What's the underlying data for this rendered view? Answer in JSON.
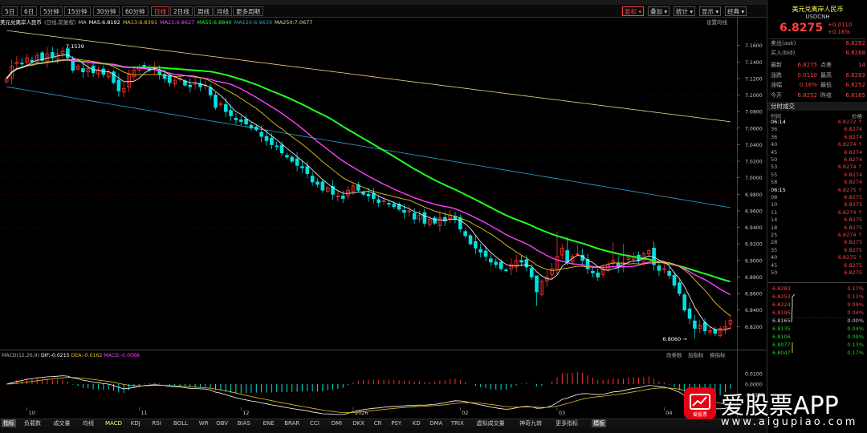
{
  "toolbar": {
    "periods": [
      "5日",
      "6日",
      "5分钟",
      "15分钟",
      "30分钟",
      "60分钟",
      "日线",
      "2日线",
      "周线",
      "月线",
      "更多周期"
    ],
    "active_index": 6,
    "right_buttons": [
      "复权",
      "叠加",
      "统计",
      "显示",
      "经典"
    ]
  },
  "info": {
    "symbol": "美元兑离岸人民币",
    "note": "(日线,前复权)",
    "ma_label": "MA",
    "ma5": "MA5:6.8192",
    "ma13": "MA13:6.8391",
    "ma21": "MA21:6.8627",
    "ma55": "MA55:6.8840",
    "ma120": "MA120:6.9639",
    "ma250": "MA250:7.0677",
    "settings": "设置均线"
  },
  "colors": {
    "up": "#ff3030",
    "down": "#00e0e0",
    "ma5": "#ffffff",
    "ma13": "#e8c020",
    "ma21": "#ff40ff",
    "ma55": "#20ff20",
    "ma120": "#30a0d0",
    "ma250": "#e8d890",
    "grid": "#6a0000",
    "axis_text": "#c8c8c8"
  },
  "chart_data": {
    "type": "candlestick",
    "ylim": [
      6.8,
      7.18
    ],
    "y_ticks": [
      7.16,
      7.14,
      7.12,
      7.1,
      7.08,
      7.06,
      7.04,
      7.02,
      7.0,
      6.98,
      6.96,
      6.94,
      6.92,
      6.9,
      6.88,
      6.86,
      6.84,
      6.82
    ],
    "y_tick_labels": [
      "7.1600",
      "7.1400",
      "7.1200",
      "7.1000",
      "7.0800",
      "7.0600",
      "7.0400",
      "7.0200",
      "7.0000",
      "6.9800",
      "6.9600",
      "6.9400",
      "6.9200",
      "6.9000",
      "6.8800",
      "6.8600",
      "6.8400",
      "6.8200"
    ],
    "x_labels": [
      {
        "label": "10",
        "index": 4
      },
      {
        "label": "11",
        "index": 26
      },
      {
        "label": "12",
        "index": 46
      },
      {
        "label": "2026",
        "index": 68
      },
      {
        "label": "02",
        "index": 89
      },
      {
        "label": "03",
        "index": 108
      },
      {
        "label": "04",
        "index": 129
      }
    ],
    "high_annotation": {
      "label": "7.1539",
      "index": 11,
      "value": 7.1539
    },
    "low_annotation": {
      "label": "6.8060",
      "index": 135,
      "value": 6.806
    },
    "closes": [
      7.12,
      7.135,
      7.14,
      7.138,
      7.145,
      7.14,
      7.148,
      7.142,
      7.15,
      7.146,
      7.15,
      7.153,
      7.145,
      7.13,
      7.135,
      7.128,
      7.132,
      7.127,
      7.13,
      7.125,
      7.128,
      7.115,
      7.105,
      7.108,
      7.125,
      7.13,
      7.133,
      7.135,
      7.13,
      7.132,
      7.125,
      7.12,
      7.115,
      7.118,
      7.12,
      7.112,
      7.11,
      7.115,
      7.11,
      7.112,
      7.1,
      7.085,
      7.09,
      7.08,
      7.075,
      7.07,
      7.068,
      7.065,
      7.06,
      7.058,
      7.05,
      7.045,
      7.04,
      7.038,
      7.03,
      7.025,
      7.02,
      7.015,
      7.012,
      7.005,
      6.995,
      6.992,
      6.985,
      6.988,
      6.98,
      6.978,
      6.975,
      6.985,
      6.99,
      6.985,
      6.98,
      6.978,
      6.975,
      6.97,
      6.972,
      6.968,
      6.965,
      6.962,
      6.958,
      6.96,
      6.95,
      6.955,
      6.945,
      6.95,
      6.945,
      6.952,
      6.948,
      6.955,
      6.95,
      6.938,
      6.93,
      6.92,
      6.915,
      6.91,
      6.905,
      6.898,
      6.895,
      6.89,
      6.888,
      6.895,
      6.9,
      6.898,
      6.892,
      6.88,
      6.862,
      6.875,
      6.88,
      6.89,
      6.905,
      6.915,
      6.898,
      6.905,
      6.908,
      6.9,
      6.89,
      6.885,
      6.88,
      6.89,
      6.895,
      6.9,
      6.892,
      6.898,
      6.903,
      6.905,
      6.9,
      6.908,
      6.912,
      6.895,
      6.888,
      6.89,
      6.882,
      6.87,
      6.86,
      6.84,
      6.83,
      6.818,
      6.822,
      6.815,
      6.815,
      6.812,
      6.818,
      6.82,
      6.8275
    ],
    "ma_values": {
      "ma5": 6.8192,
      "ma13": 6.8391,
      "ma21": 6.8627,
      "ma55": 6.884,
      "ma120": 6.9639,
      "ma250": 7.0677
    },
    "macd": {
      "params": "MACD(12,26,9)",
      "dif": -0.0215,
      "dea": -0.0162,
      "macd": -0.0068,
      "dif_label": "DIF:-0.0215",
      "dea_label": "DEA:-0.0162",
      "macd_label": "MACD:-0.0068",
      "ylim": [
        -0.025,
        0.025
      ],
      "ticks": [
        0.01,
        0.0,
        -0.01
      ],
      "tick_labels": [
        "0.0100",
        "0.0000",
        "-0.0100"
      ]
    },
    "sub_tools": [
      "改参数",
      "加指标",
      "换指标"
    ]
  },
  "bottom_tabs": [
    "指标",
    "负载数",
    "成交量",
    "均线",
    "MACD",
    "KDJ",
    "RSI",
    "BOLL",
    "WR",
    "OBV",
    "BIAS",
    "ENE",
    "BRAR",
    "CCI",
    "DMI",
    "DKX",
    "CR",
    "PSY",
    "KD",
    "DMA",
    "TRIX",
    "虚拟成交量",
    "神奇九转",
    "更多指标",
    "模板"
  ],
  "right_panel": {
    "name": "美元兑离岸人民币",
    "code": "USDCNH",
    "price": "6.8275",
    "change": "+0.0110",
    "change_pct": "+0.16%",
    "ask_label": "卖出(ask)",
    "ask_value": "6.8282",
    "bid_label": "买入(bid)",
    "bid_value": "6.8268",
    "stats": [
      {
        "l": "最新",
        "v": "6.8275",
        "l2": "点差",
        "v2": "14"
      },
      {
        "l": "涨跌",
        "v": "0.0110",
        "l2": "最高",
        "v2": "6.8283"
      },
      {
        "l": "涨幅",
        "v": "0.16%",
        "l2": "最低",
        "v2": "6.8252"
      },
      {
        "l": "今开",
        "v": "6.8252",
        "l2": "昨收",
        "v2": "6.8165"
      }
    ],
    "ticks_title": "分时成交",
    "ticks_head_time": "时间",
    "ticks_head_price": "价格",
    "ticks": [
      {
        "t": "06:14",
        "p": "6.8272"
      },
      {
        "t": "36",
        "p": "6.8274"
      },
      {
        "t": "36",
        "p": "6.8274"
      },
      {
        "t": "40",
        "p": "6.8274"
      },
      {
        "t": "45",
        "p": "6.8274"
      },
      {
        "t": "50",
        "p": "6.8274"
      },
      {
        "t": "53",
        "p": "6.8274"
      },
      {
        "t": "55",
        "p": "6.8274"
      },
      {
        "t": "58",
        "p": "6.8274"
      },
      {
        "t": "06:15",
        "p": "6.8275"
      },
      {
        "t": "08",
        "p": "6.8275"
      },
      {
        "t": "10",
        "p": "6.8275"
      },
      {
        "t": "11",
        "p": "6.8274"
      },
      {
        "t": "14",
        "p": "6.8275"
      },
      {
        "t": "18",
        "p": "6.8275"
      },
      {
        "t": "25",
        "p": "6.8274"
      },
      {
        "t": "28",
        "p": "6.8275"
      },
      {
        "t": "35",
        "p": "6.8275"
      },
      {
        "t": "40",
        "p": "6.8275"
      },
      {
        "t": "45",
        "p": "6.8275"
      },
      {
        "t": "50",
        "p": "6.8275"
      }
    ],
    "mini": [
      {
        "p": "6.8283",
        "c": "0.17%",
        "col": "#ff4040"
      },
      {
        "p": "6.8253",
        "c": "0.13%",
        "col": "#ff4040"
      },
      {
        "p": "6.8224",
        "c": "0.09%",
        "col": "#ff4040"
      },
      {
        "p": "6.8195",
        "c": "0.04%",
        "col": "#ff4040"
      },
      {
        "p": "6.8165",
        "c": "0.00%",
        "col": "#cccccc"
      },
      {
        "p": "6.8135",
        "c": "0.04%",
        "col": "#20d020"
      },
      {
        "p": "6.8106",
        "c": "0.09%",
        "col": "#20d020"
      },
      {
        "p": "6.8077",
        "c": "0.13%",
        "col": "#20d020"
      },
      {
        "p": "6.8047",
        "c": "0.17%",
        "col": "#20d020"
      }
    ]
  },
  "logo": {
    "text": "爱股票APP",
    "url": "www.aigupiao.com",
    "badge": "爱股票"
  }
}
